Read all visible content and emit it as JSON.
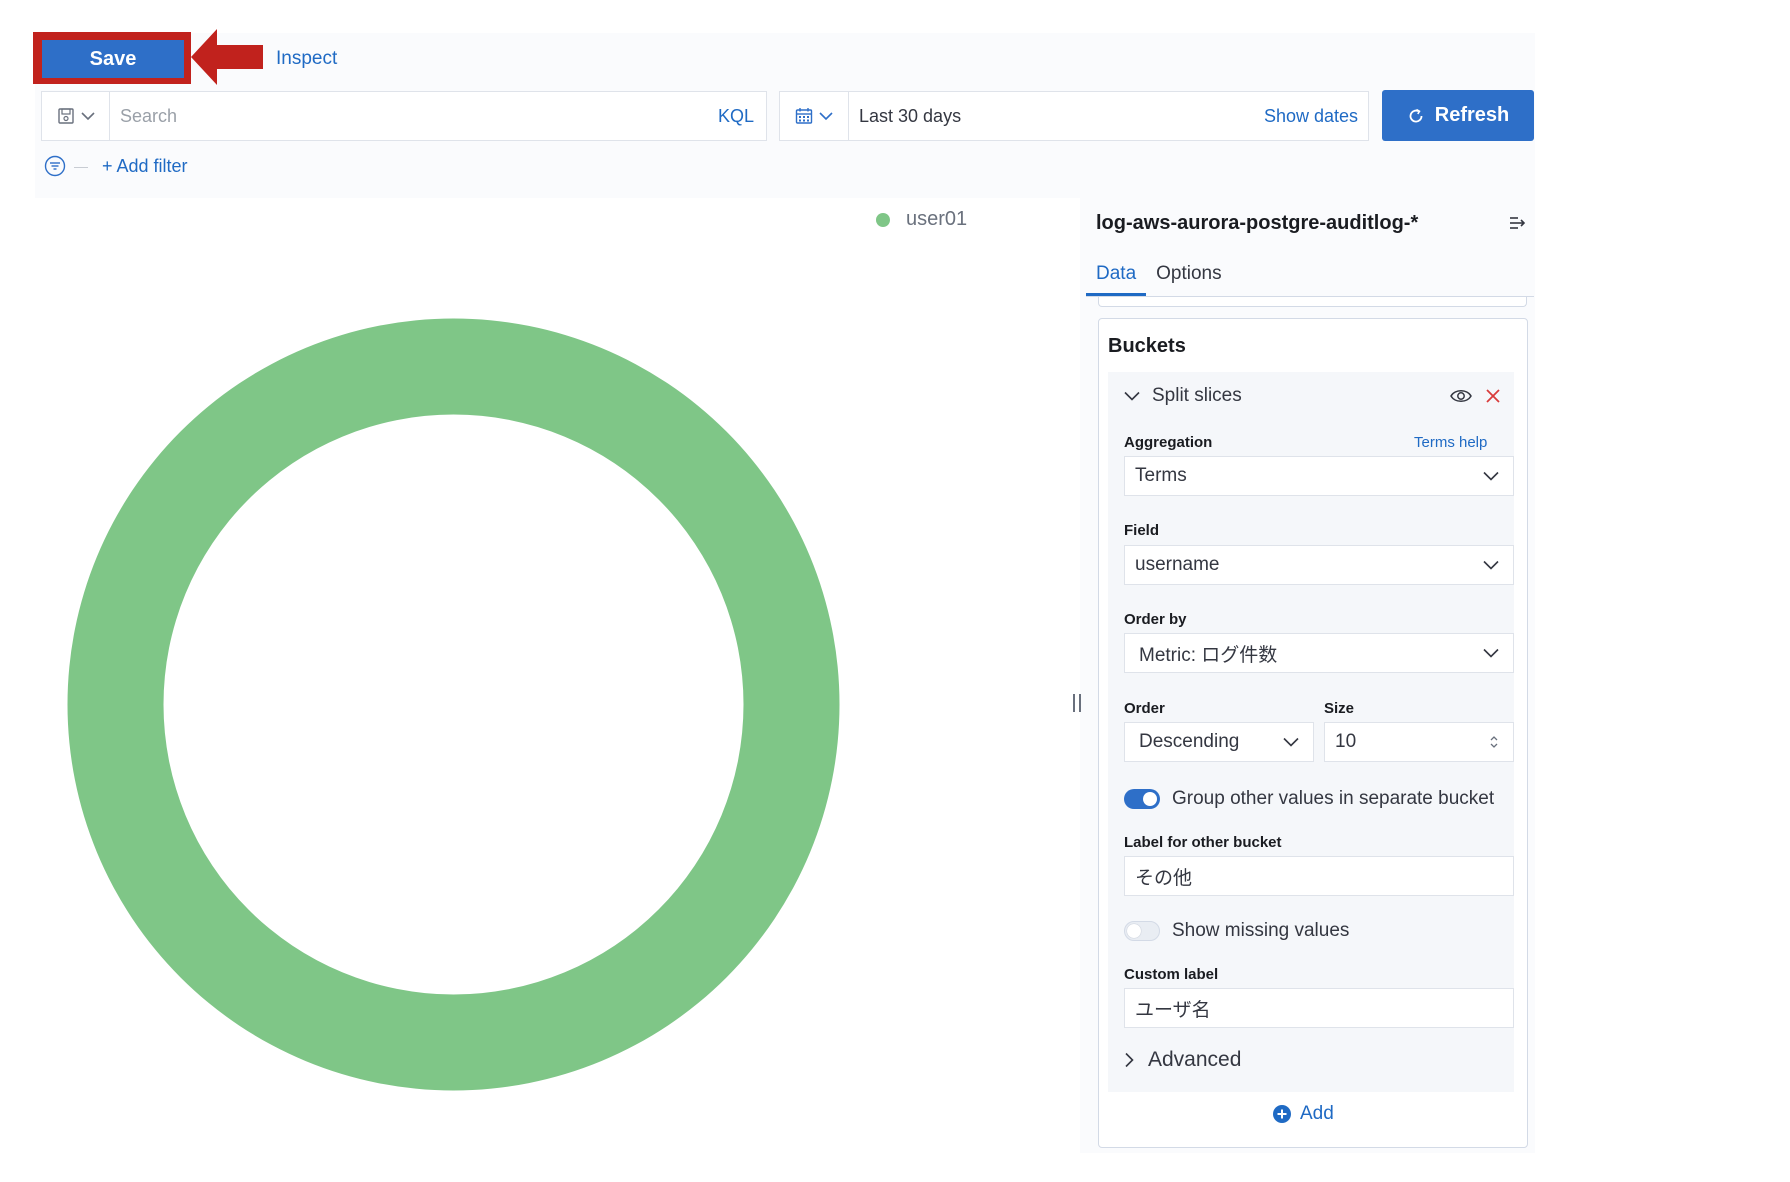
{
  "toolbar": {
    "save_label": "Save",
    "inspect_label": "Inspect"
  },
  "query_bar": {
    "search_placeholder": "Search",
    "kql_label": "KQL"
  },
  "date_picker": {
    "range_label": "Last 30 days",
    "show_dates_label": "Show dates"
  },
  "refresh_label": "Refresh",
  "filter": {
    "add_filter_label": "+ Add filter"
  },
  "legend": {
    "items": [
      {
        "label": "user01",
        "color": "#7fc687"
      }
    ]
  },
  "chart_data": {
    "type": "pie",
    "donut": true,
    "categories": [
      "user01"
    ],
    "values": [
      100
    ],
    "colors": [
      "#7fc687"
    ]
  },
  "sidebar": {
    "index_pattern": "log-aws-aurora-postgre-auditlog-*",
    "tabs": [
      {
        "label": "Data",
        "active": true
      },
      {
        "label": "Options",
        "active": false
      }
    ],
    "buckets": {
      "title": "Buckets",
      "split_title": "Split slices",
      "aggregation_label": "Aggregation",
      "aggregation_help": "Terms help",
      "aggregation_value": "Terms",
      "field_label": "Field",
      "field_value": "username",
      "order_by_label": "Order by",
      "order_by_value": "Metric: ログ件数",
      "order_label": "Order",
      "order_value": "Descending",
      "size_label": "Size",
      "size_value": "10",
      "group_other_label": "Group other values in separate bucket",
      "group_other_enabled": true,
      "other_bucket_label": "Label for other bucket",
      "other_bucket_value": "その他",
      "show_missing_label": "Show missing values",
      "show_missing_enabled": false,
      "custom_label_label": "Custom label",
      "custom_label_value": "ユーザ名",
      "advanced_label": "Advanced",
      "add_label": "Add"
    }
  },
  "colors": {
    "accent": "#2e6fc8",
    "link": "#1f6ac4",
    "highlight": "#c1221d",
    "delete": "#d93b3b"
  }
}
